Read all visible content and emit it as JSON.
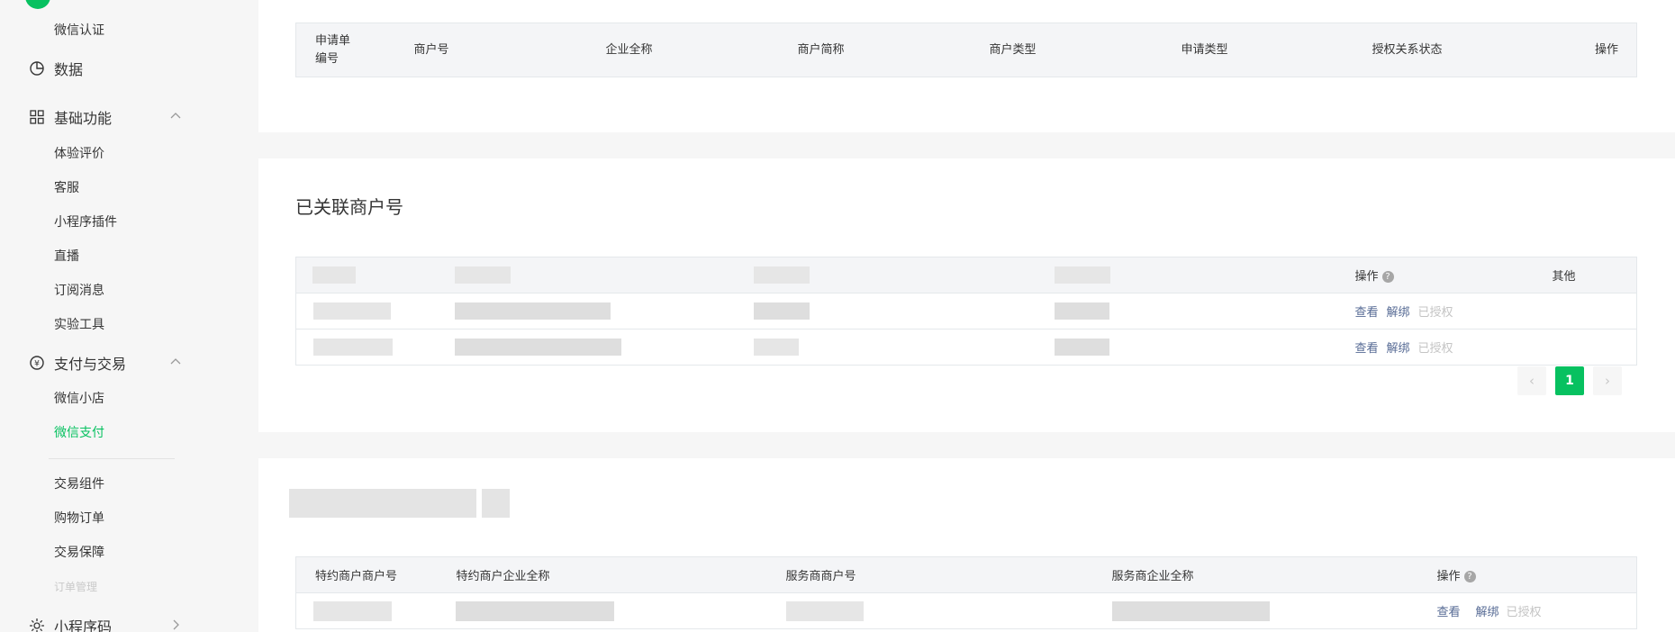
{
  "sidebar": {
    "top_item": "微信认证",
    "data_label": "数据",
    "basic": {
      "label": "基础功能",
      "items": [
        "体验评价",
        "客服",
        "小程序插件",
        "直播",
        "订阅消息",
        "实验工具"
      ]
    },
    "pay": {
      "label": "支付与交易",
      "items": [
        "微信小店",
        "微信支付"
      ],
      "items2": [
        "交易组件",
        "购物订单",
        "交易保障",
        "订单管理"
      ]
    },
    "qrcode_label": "小程序码",
    "active_item": "微信支付"
  },
  "table1": {
    "headers": [
      "申请单编号",
      "商户号",
      "企业全称",
      "商户简称",
      "商户类型",
      "申请类型",
      "授权关系状态",
      "操作"
    ]
  },
  "section2": {
    "title": "已关联商户号",
    "headers": {
      "ops": "操作",
      "other": "其他"
    },
    "help_glyph": "?",
    "rows": [
      {
        "view": "查看",
        "unbind": "解绑",
        "status": "已授权"
      },
      {
        "view": "查看",
        "unbind": "解绑",
        "status": "已授权"
      }
    ],
    "pagination": {
      "prev": "‹",
      "current": "1",
      "next": "›"
    }
  },
  "section3": {
    "headers": [
      "特约商户商户号",
      "特约商户企业全称",
      "服务商商户号",
      "服务商企业全称",
      "操作"
    ],
    "help_glyph": "?",
    "rows": [
      {
        "view": "查看",
        "unbind": "解绑",
        "status": "已授权"
      }
    ]
  },
  "colors": {
    "accent": "#07c160",
    "link": "#576b95",
    "muted": "#c4c4c4",
    "header_bg": "#f4f5f7"
  }
}
